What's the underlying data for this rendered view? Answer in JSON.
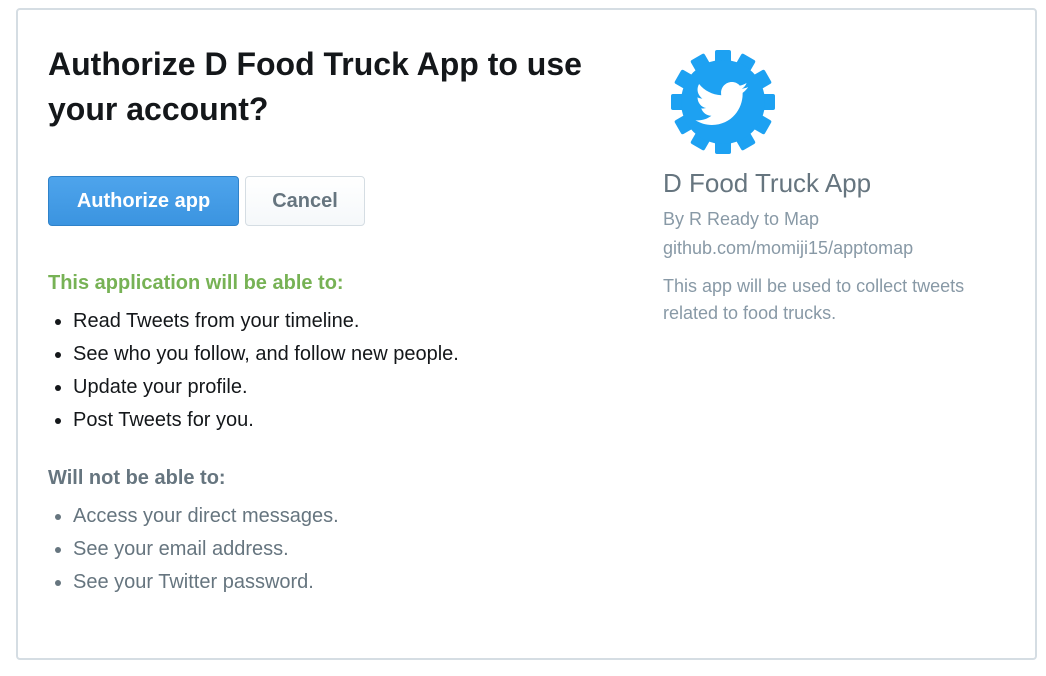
{
  "auth": {
    "title": "Authorize D Food Truck App to use your account?",
    "authorize_label": "Authorize app",
    "cancel_label": "Cancel",
    "can_heading": "This application will be able to:",
    "can_items": [
      "Read Tweets from your timeline.",
      "See who you follow, and follow new people.",
      "Update your profile.",
      "Post Tweets for you."
    ],
    "cannot_heading": "Will not be able to:",
    "cannot_items": [
      "Access your direct messages.",
      "See your email address.",
      "See your Twitter password."
    ]
  },
  "app": {
    "logo_icon": "twitter-gear-logo-icon",
    "name": "D Food Truck App",
    "by": "By R Ready to Map",
    "url": "github.com/momiji15/apptomap",
    "description": "This app will be used to collect tweets related to food trucks."
  },
  "colors": {
    "primary": "#3b94e0",
    "success": "#77b255",
    "muted": "#8899a6",
    "logo": "#1da1f2"
  }
}
